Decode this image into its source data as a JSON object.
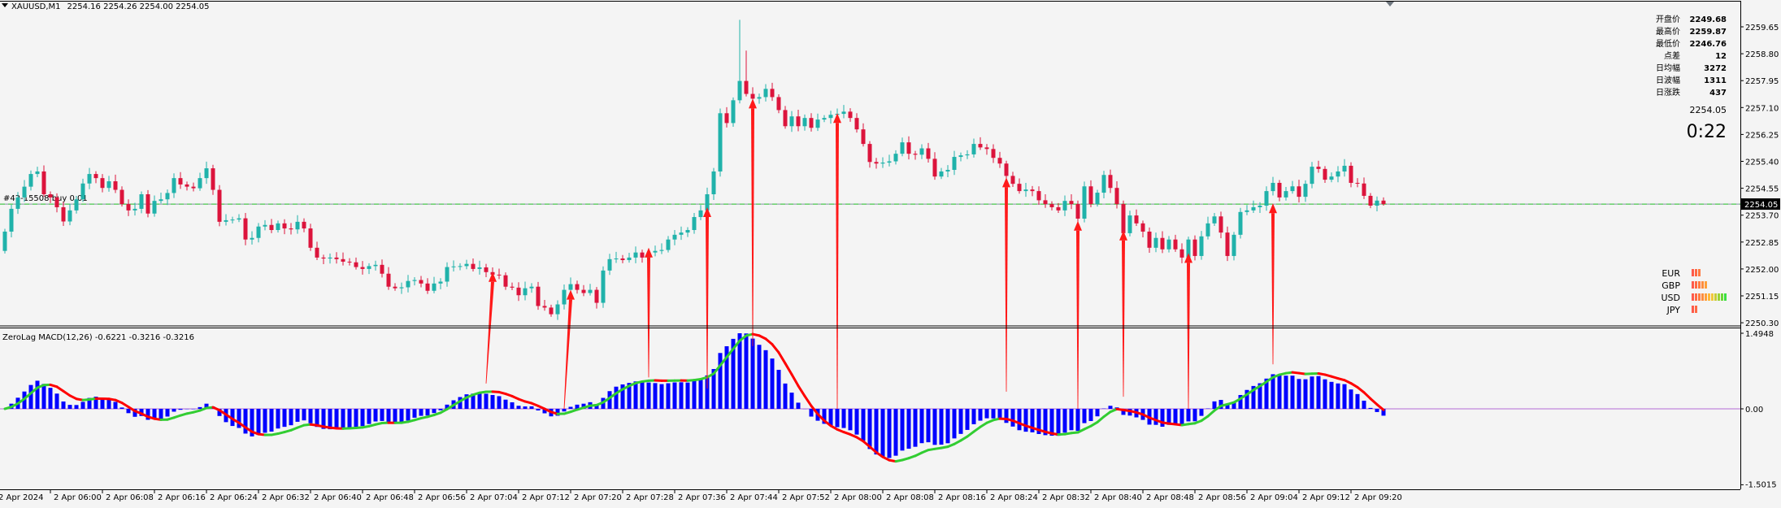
{
  "header": {
    "symbol_timeframe": "XAUUSD,M1",
    "ohlc": "2254.16 2254.26 2254.00 2254.05"
  },
  "order_line": {
    "label": "#42-15508 buy 0.01",
    "price": 2254.05
  },
  "info_panel": {
    "rows": [
      {
        "label": "开盘价",
        "value": "2249.68"
      },
      {
        "label": "最高价",
        "value": "2259.87"
      },
      {
        "label": "最低价",
        "value": "2246.76"
      },
      {
        "label": "点差",
        "value": "12"
      },
      {
        "label": "日均幅",
        "value": "3272"
      },
      {
        "label": "日波幅",
        "value": "1311"
      },
      {
        "label": "日涨跌",
        "value": "437"
      }
    ],
    "bid": "2254.05",
    "countdown": "0:22"
  },
  "currency_strength": [
    {
      "name": "EUR",
      "level": 3
    },
    {
      "name": "GBP",
      "level": 5
    },
    {
      "name": "USD",
      "level": 11
    },
    {
      "name": "JPY",
      "level": 2
    }
  ],
  "colors": {
    "bull": "#20b2aa",
    "bear": "#dc143c",
    "histogram": "#0000ff",
    "signal_up": "#32cd32",
    "signal_down": "#ff0000",
    "zero_line": "#b36ad6",
    "arrow": "#ff1a1a",
    "bid_line": "#32cd32"
  },
  "chart_data": [
    {
      "type": "candlestick",
      "title": "XAUUSD,M1",
      "first_bar_time": "2 Apr 2024 05:53",
      "bar_interval_minutes": 1,
      "first_open": 2252.57,
      "close": [
        2253.18,
        2253.9,
        2254.26,
        2254.6,
        2255.0,
        2255.08,
        2254.36,
        2254.26,
        2253.95,
        2253.5,
        2253.85,
        2254.2,
        2254.7,
        2255.0,
        2254.87,
        2254.56,
        2254.77,
        2254.5,
        2254.05,
        2253.85,
        2253.9,
        2254.36,
        2253.75,
        2254.15,
        2254.2,
        2254.4,
        2254.87,
        2254.67,
        2254.6,
        2254.55,
        2254.87,
        2255.18,
        2254.5,
        2253.49,
        2253.54,
        2253.56,
        2253.6,
        2252.93,
        2252.98,
        2253.34,
        2253.39,
        2253.23,
        2253.44,
        2253.28,
        2253.25,
        2253.49,
        2253.28,
        2252.67,
        2252.36,
        2252.33,
        2252.36,
        2252.31,
        2252.23,
        2252.21,
        2252.06,
        2252.0,
        2252.09,
        2252.13,
        2251.85,
        2251.44,
        2251.39,
        2251.42,
        2251.62,
        2251.65,
        2251.54,
        2251.31,
        2251.54,
        2251.6,
        2252.06,
        2252.08,
        2252.09,
        2252.16,
        2252.0,
        2252.05,
        2251.9,
        2251.82,
        2251.8,
        2251.44,
        2251.41,
        2251.17,
        2251.39,
        2251.44,
        2250.83,
        2250.78,
        2250.57,
        2250.88,
        2251.34,
        2251.52,
        2251.34,
        2251.24,
        2251.34,
        2250.93,
        2251.95,
        2252.31,
        2252.33,
        2252.28,
        2252.36,
        2252.52,
        2252.36,
        2252.52,
        2252.57,
        2252.6,
        2252.93,
        2253.08,
        2253.15,
        2253.23,
        2253.64,
        2253.85,
        2254.36,
        2255.08,
        2256.92,
        2256.61,
        2257.33,
        2257.94,
        2257.53,
        2257.38,
        2257.43,
        2257.69,
        2257.43,
        2257.02,
        2256.51,
        2256.82,
        2256.51,
        2256.77,
        2256.46,
        2256.72,
        2256.77,
        2256.87,
        2256.9,
        2256.97,
        2256.77,
        2256.41,
        2255.95,
        2255.38,
        2255.33,
        2255.36,
        2255.4,
        2255.64,
        2256.0,
        2255.64,
        2255.61,
        2255.81,
        2255.48,
        2254.92,
        2255.08,
        2255.13,
        2255.54,
        2255.59,
        2255.62,
        2255.95,
        2255.84,
        2255.79,
        2255.51,
        2255.33,
        2254.94,
        2254.69,
        2254.46,
        2254.51,
        2254.46,
        2254.17,
        2254.05,
        2253.95,
        2253.85,
        2254.15,
        2254.05,
        2253.59,
        2254.61,
        2254.05,
        2254.41,
        2254.97,
        2254.56,
        2254.05,
        2253.13,
        2253.69,
        2253.44,
        2253.18,
        2252.67,
        2252.98,
        2252.62,
        2252.93,
        2252.62,
        2252.36,
        2252.93,
        2252.41,
        2253.03,
        2253.44,
        2253.66,
        2253.15,
        2252.41,
        2253.08,
        2253.8,
        2253.85,
        2253.95,
        2254.0,
        2254.46,
        2254.72,
        2254.26,
        2254.46,
        2254.61,
        2254.28,
        2254.69,
        2255.23,
        2255.16,
        2254.82,
        2254.92,
        2255.08,
        2255.26,
        2254.72,
        2254.7,
        2254.31,
        2254.0,
        2254.16,
        2254.05
      ],
      "high_overrides": [
        {
          "time": "07:46",
          "high": 2259.87
        },
        {
          "time": "07:47",
          "high": 2258.9
        }
      ],
      "last_bar": {
        "open": 2254.16,
        "high": 2254.26,
        "low": 2254.0,
        "close": 2254.05
      },
      "ylim": [
        2249.95,
        2260.5
      ],
      "y_ticks": [
        "2259.65",
        "2258.80",
        "2257.95",
        "2257.10",
        "2256.25",
        "2255.40",
        "2254.55",
        "2253.70",
        "2252.85",
        "2252.00",
        "2251.15",
        "2250.30"
      ],
      "current_price_label": "2254.05",
      "x_tick_labels": [
        "2 Apr 2024",
        "2 Apr 06:00",
        "2 Apr 06:08",
        "2 Apr 06:16",
        "2 Apr 06:24",
        "2 Apr 06:32",
        "2 Apr 06:40",
        "2 Apr 06:48",
        "2 Apr 06:56",
        "2 Apr 07:04",
        "2 Apr 07:12",
        "2 Apr 07:20",
        "2 Apr 07:28",
        "2 Apr 07:36",
        "2 Apr 07:44",
        "2 Apr 07:52",
        "2 Apr 08:00",
        "2 Apr 08:08",
        "2 Apr 08:16",
        "2 Apr 08:24",
        "2 Apr 08:32",
        "2 Apr 08:40",
        "2 Apr 08:48",
        "2 Apr 08:56",
        "2 Apr 09:04",
        "2 Apr 09:12",
        "2 Apr 09:20"
      ],
      "grid": false
    },
    {
      "type": "bar+line",
      "title": "ZeroLag MACD(12,26) -0.6221 -0.3216 -0.3216",
      "fast": 12,
      "slow": 26,
      "signal": 9,
      "ylim": [
        -1.5015,
        1.4948
      ],
      "y_ticks": [
        "1.4948",
        "0.00",
        "-1.5015"
      ],
      "zero_line": 0
    }
  ],
  "signal_arrows": [
    {
      "from_time": "07:07",
      "from_macd": 0.5,
      "to_time": "07:08",
      "to_price": 2251.9
    },
    {
      "from_time": "07:19",
      "from_macd": 0.0,
      "to_time": "07:20",
      "to_price": 2251.34
    },
    {
      "from_time": "07:32",
      "from_macd": 0.62,
      "to_time": "07:32",
      "to_price": 2252.67
    },
    {
      "from_time": "07:41",
      "from_macd": 0.4,
      "to_time": "07:41",
      "to_price": 2253.95
    },
    {
      "from_time": "07:48",
      "from_macd": 1.24,
      "to_time": "07:48",
      "to_price": 2257.38
    },
    {
      "from_time": "08:01",
      "from_macd": 0.0,
      "to_time": "08:01",
      "to_price": 2256.92
    },
    {
      "from_time": "08:27",
      "from_macd": 0.34,
      "to_time": "08:27",
      "to_price": 2254.89
    },
    {
      "from_time": "08:38",
      "from_macd": 0.0,
      "to_time": "08:38",
      "to_price": 2253.52
    },
    {
      "from_time": "08:45",
      "from_macd": 0.24,
      "to_time": "08:45",
      "to_price": 2253.21
    },
    {
      "from_time": "08:55",
      "from_macd": 0.0,
      "to_time": "08:55",
      "to_price": 2252.5
    },
    {
      "from_time": "09:08",
      "from_macd": 0.88,
      "to_time": "09:08",
      "to_price": 2254.07
    }
  ]
}
